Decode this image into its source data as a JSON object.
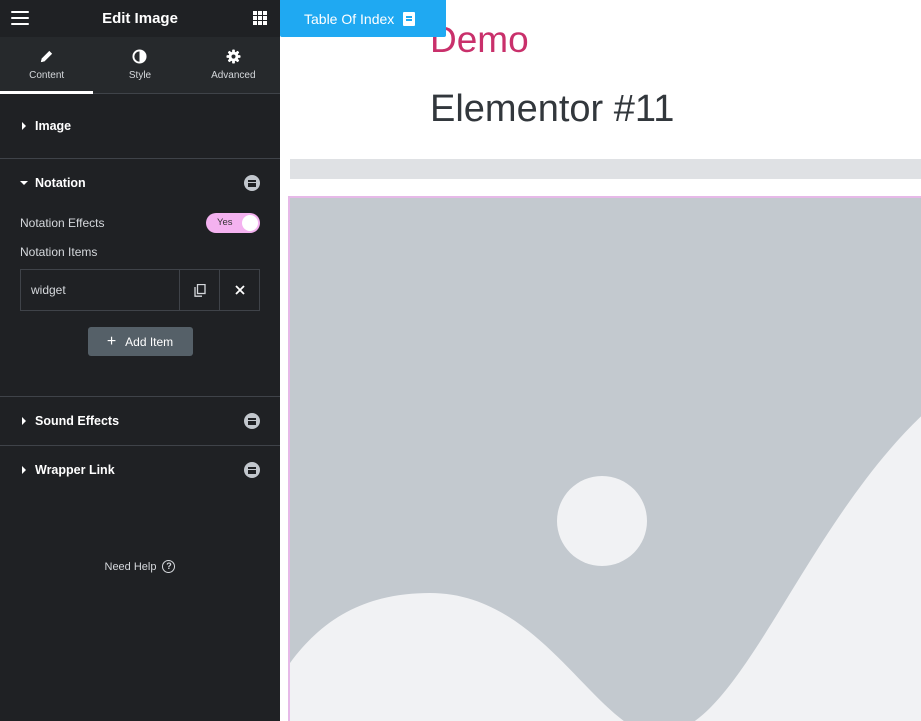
{
  "panel": {
    "header": {
      "title": "Edit Image",
      "menu_icon": "hamburger-icon",
      "grid_icon": "apps-grid-icon"
    },
    "tabs": [
      {
        "label": "Content",
        "icon": "pencil-icon",
        "active": true
      },
      {
        "label": "Style",
        "icon": "half-circle-icon",
        "active": false
      },
      {
        "label": "Advanced",
        "icon": "gear-icon",
        "active": false
      }
    ],
    "sections": {
      "image": {
        "label": "Image",
        "expanded": false
      },
      "notation": {
        "label": "Notation",
        "expanded": true,
        "effects_label": "Notation Effects",
        "effects_toggle": "Yes",
        "items_label": "Notation Items",
        "items": [
          {
            "title": "widget"
          }
        ],
        "add_item_label": "Add Item"
      },
      "sound_effects": {
        "label": "Sound Effects",
        "expanded": false
      },
      "wrapper_link": {
        "label": "Wrapper Link",
        "expanded": false
      }
    },
    "need_help": "Need Help"
  },
  "preview": {
    "table_of_index_button": "Table Of Index",
    "demo_text": "Demo",
    "page_title": "Elementor #11"
  },
  "colors": {
    "panel_bg": "#1f2124",
    "accent_toggle": "#f4b2f0",
    "toi_button": "#1fa9f2",
    "demo_text": "#c9306b",
    "title_text": "#32373c",
    "image_placeholder": "#c3c9cf"
  }
}
